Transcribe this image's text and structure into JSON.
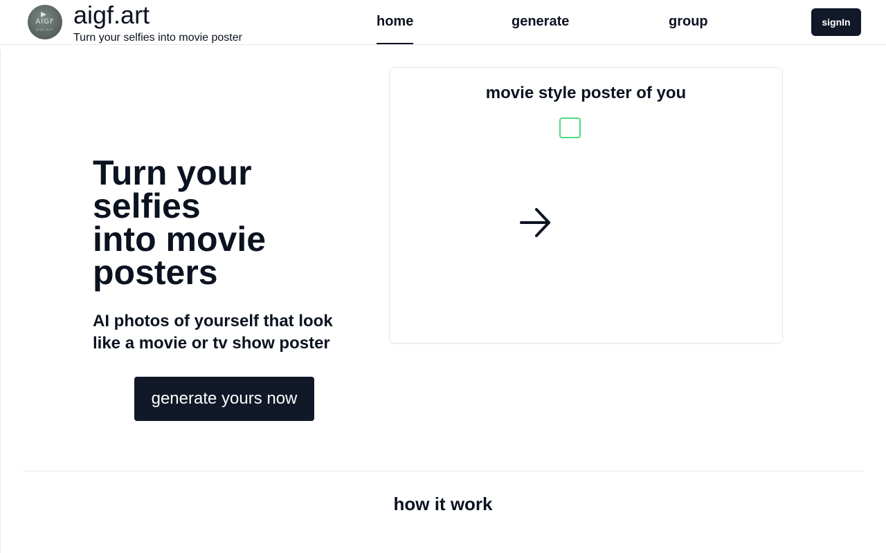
{
  "header": {
    "brand_name": "aigf.art",
    "tagline": "Turn your selfies into movie poster",
    "logo_text": "AIGF",
    "logo_subtext": "AIGF.ART",
    "nav": [
      {
        "label": "home",
        "active": true
      },
      {
        "label": "generate",
        "active": false
      },
      {
        "label": "group",
        "active": false
      }
    ],
    "signin_label": "signIn"
  },
  "hero": {
    "title_lines": [
      "Turn your",
      "selfies",
      "into movie",
      "posters"
    ],
    "subtitle": "AI photos of yourself that look like a movie or tv show poster",
    "cta_label": "generate yours now"
  },
  "card": {
    "title": "movie style poster of you",
    "arrow_icon": "arrow-right-icon"
  },
  "section": {
    "title": "how it work"
  },
  "colors": {
    "primary": "#111827",
    "text": "#0b1220",
    "border": "#e5e7eb",
    "placeholder_border": "#4ade80"
  }
}
